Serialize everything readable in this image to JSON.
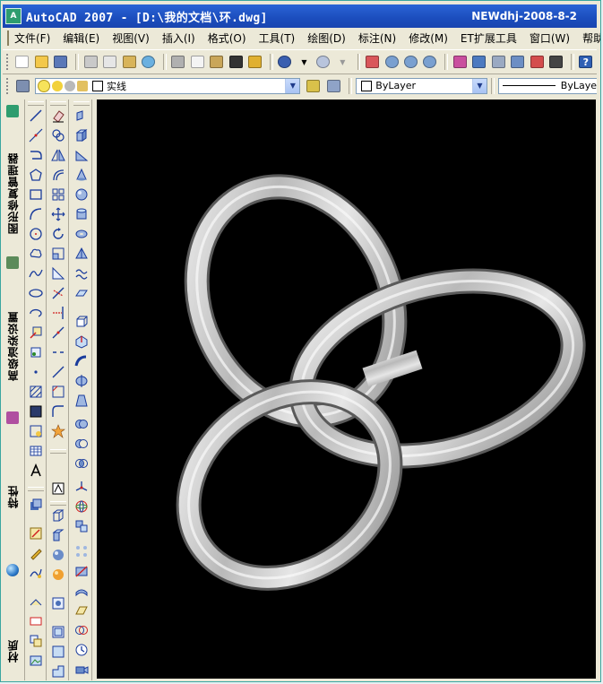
{
  "window": {
    "title": "AutoCAD 2007 - [D:\\我的文档\\环.dwg]",
    "watermark": "NEWdhj-2008-8-2",
    "app_icon_label": "A"
  },
  "menu": {
    "items": [
      "文件(F)",
      "编辑(E)",
      "视图(V)",
      "插入(I)",
      "格式(O)",
      "工具(T)",
      "绘图(D)",
      "标注(N)",
      "修改(M)",
      "ET扩展工具",
      "窗口(W)",
      "帮助"
    ]
  },
  "layer_bar": {
    "current_layer": "实线",
    "color": "ByLayer",
    "linetype": "ByLaye"
  },
  "palette_tabs": {
    "layer_manager": "图形修复管理器",
    "render_settings": "高级渲染设置",
    "properties": "特性",
    "materials": "材质"
  },
  "colors": {
    "titlebar": "#1b4dbd",
    "viewport": "#000000",
    "accent": "#2f9d6f"
  }
}
